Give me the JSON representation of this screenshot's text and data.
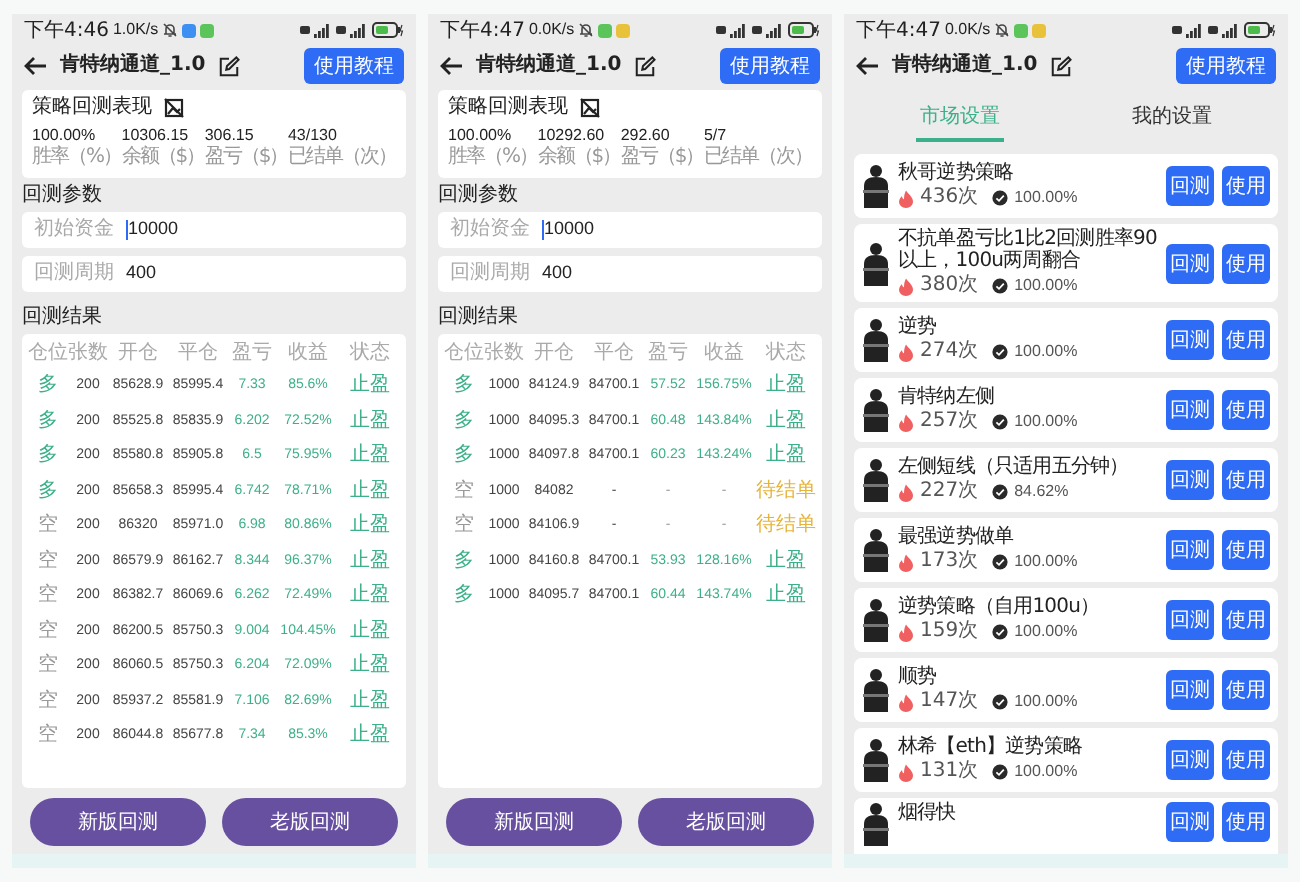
{
  "screens": [
    {
      "kind": "backtest",
      "status_bar": {
        "time": "下午4:46",
        "speed": "1.0K/s",
        "notifications": [
          {
            "color": "#3d8ff2"
          },
          {
            "color": "#5bc45b"
          }
        ]
      },
      "title": "肯特纳通道_1.0",
      "tutorial_button": "使用教程",
      "summary": {
        "title": "策略回测表现",
        "stats": [
          {
            "value": "100.00%",
            "label": "胜率（%）"
          },
          {
            "value": "10306.15",
            "label": "余额（$）"
          },
          {
            "value": "306.15",
            "label": "盈亏（$）"
          },
          {
            "value": "43/130",
            "label": "已结单（次）"
          }
        ]
      },
      "params_label": "回测参数",
      "fields": [
        {
          "label": "初始资金",
          "value": "10000",
          "focused": true
        },
        {
          "label": "回测周期",
          "value": "400",
          "focused": false
        }
      ],
      "results_label": "回测结果",
      "table": {
        "columns": [
          "仓位",
          "张数",
          "开仓",
          "平仓",
          "盈亏",
          "收益",
          "状态"
        ],
        "rows": [
          {
            "kind": "long",
            "pending": false,
            "cells": [
              "多",
              "200",
              "85628.9",
              "85995.4",
              "7.33",
              "85.6%",
              "止盈"
            ]
          },
          {
            "kind": "long",
            "pending": false,
            "cells": [
              "多",
              "200",
              "85525.8",
              "85835.9",
              "6.202",
              "72.52%",
              "止盈"
            ]
          },
          {
            "kind": "long",
            "pending": false,
            "cells": [
              "多",
              "200",
              "85580.8",
              "85905.8",
              "6.5",
              "75.95%",
              "止盈"
            ]
          },
          {
            "kind": "long",
            "pending": false,
            "cells": [
              "多",
              "200",
              "85658.3",
              "85995.4",
              "6.742",
              "78.71%",
              "止盈"
            ]
          },
          {
            "kind": "short",
            "pending": false,
            "cells": [
              "空",
              "200",
              "86320",
              "85971.0",
              "6.98",
              "80.86%",
              "止盈"
            ]
          },
          {
            "kind": "short",
            "pending": false,
            "cells": [
              "空",
              "200",
              "86579.9",
              "86162.7",
              "8.344",
              "96.37%",
              "止盈"
            ]
          },
          {
            "kind": "short",
            "pending": false,
            "cells": [
              "空",
              "200",
              "86382.7",
              "86069.6",
              "6.262",
              "72.49%",
              "止盈"
            ]
          },
          {
            "kind": "short",
            "pending": false,
            "cells": [
              "空",
              "200",
              "86200.5",
              "85750.3",
              "9.004",
              "104.45%",
              "止盈"
            ]
          },
          {
            "kind": "short",
            "pending": false,
            "cells": [
              "空",
              "200",
              "86060.5",
              "85750.3",
              "6.204",
              "72.09%",
              "止盈"
            ]
          },
          {
            "kind": "short",
            "pending": false,
            "cells": [
              "空",
              "200",
              "85937.2",
              "85581.9",
              "7.106",
              "82.69%",
              "止盈"
            ]
          },
          {
            "kind": "short",
            "pending": false,
            "cells": [
              "空",
              "200",
              "86044.8",
              "85677.8",
              "7.34",
              "85.3%",
              "止盈"
            ]
          }
        ]
      },
      "buttons": [
        "新版回测",
        "老版回测"
      ]
    },
    {
      "kind": "backtest",
      "status_bar": {
        "time": "下午4:47",
        "speed": "0.0K/s",
        "notifications": [
          {
            "color": "#5bc45b"
          },
          {
            "color": "#e8c23a"
          }
        ]
      },
      "title": "肯特纳通道_1.0",
      "tutorial_button": "使用教程",
      "summary": {
        "title": "策略回测表现",
        "stats": [
          {
            "value": "100.00%",
            "label": "胜率（%）"
          },
          {
            "value": "10292.60",
            "label": "余额（$）"
          },
          {
            "value": "292.60",
            "label": "盈亏（$）"
          },
          {
            "value": "5/7",
            "label": "已结单（次）"
          }
        ]
      },
      "params_label": "回测参数",
      "fields": [
        {
          "label": "初始资金",
          "value": "10000",
          "focused": true
        },
        {
          "label": "回测周期",
          "value": "400",
          "focused": false
        }
      ],
      "results_label": "回测结果",
      "table": {
        "columns": [
          "仓位",
          "张数",
          "开仓",
          "平仓",
          "盈亏",
          "收益",
          "状态"
        ],
        "rows": [
          {
            "kind": "long",
            "pending": false,
            "cells": [
              "多",
              "1000",
              "84124.9",
              "84700.1",
              "57.52",
              "156.75%",
              "止盈"
            ]
          },
          {
            "kind": "long",
            "pending": false,
            "cells": [
              "多",
              "1000",
              "84095.3",
              "84700.1",
              "60.48",
              "143.84%",
              "止盈"
            ]
          },
          {
            "kind": "long",
            "pending": false,
            "cells": [
              "多",
              "1000",
              "84097.8",
              "84700.1",
              "60.23",
              "143.24%",
              "止盈"
            ]
          },
          {
            "kind": "short",
            "pending": true,
            "cells": [
              "空",
              "1000",
              "84082",
              "-",
              "-",
              "-",
              "待结单"
            ]
          },
          {
            "kind": "short",
            "pending": true,
            "cells": [
              "空",
              "1000",
              "84106.9",
              "-",
              "-",
              "-",
              "待结单"
            ]
          },
          {
            "kind": "long",
            "pending": false,
            "cells": [
              "多",
              "1000",
              "84160.8",
              "84700.1",
              "53.93",
              "128.16%",
              "止盈"
            ]
          },
          {
            "kind": "long",
            "pending": false,
            "cells": [
              "多",
              "1000",
              "84095.7",
              "84700.1",
              "60.44",
              "143.74%",
              "止盈"
            ]
          }
        ]
      },
      "buttons": [
        "新版回测",
        "老版回测"
      ]
    },
    {
      "kind": "market",
      "status_bar": {
        "time": "下午4:47",
        "speed": "0.0K/s",
        "notifications": [
          {
            "color": "#5bc45b"
          },
          {
            "color": "#e8c23a"
          }
        ]
      },
      "title": "肯特纳通道_1.0",
      "tutorial_button": "使用教程",
      "tabs": [
        {
          "label": "市场设置",
          "selected": true
        },
        {
          "label": "我的设置",
          "selected": false
        }
      ],
      "strategies": [
        {
          "name": "秋哥逆势策略",
          "count": "436次",
          "rate": "100.00%",
          "actions": [
            "回测",
            "使用"
          ]
        },
        {
          "name": "不抗单盈亏比1比2回测胜率90以上，100u两周翻合",
          "count": "380次",
          "rate": "100.00%",
          "actions": [
            "回测",
            "使用"
          ]
        },
        {
          "name": "逆势",
          "count": "274次",
          "rate": "100.00%",
          "actions": [
            "回测",
            "使用"
          ]
        },
        {
          "name": "肯特纳左侧",
          "count": "257次",
          "rate": "100.00%",
          "actions": [
            "回测",
            "使用"
          ]
        },
        {
          "name": "左侧短线（只适用五分钟）",
          "count": "227次",
          "rate": "84.62%",
          "actions": [
            "回测",
            "使用"
          ]
        },
        {
          "name": "最强逆势做单",
          "count": "173次",
          "rate": "100.00%",
          "actions": [
            "回测",
            "使用"
          ]
        },
        {
          "name": "逆势策略（自用100u）",
          "count": "159次",
          "rate": "100.00%",
          "actions": [
            "回测",
            "使用"
          ]
        },
        {
          "name": "顺势",
          "count": "147次",
          "rate": "100.00%",
          "actions": [
            "回测",
            "使用"
          ]
        },
        {
          "name": "林希【eth】逆势策略",
          "count": "131次",
          "rate": "100.00%",
          "actions": [
            "回测",
            "使用"
          ]
        },
        {
          "name": "烟得快",
          "actions": [
            "回测",
            "使用"
          ]
        }
      ]
    }
  ]
}
